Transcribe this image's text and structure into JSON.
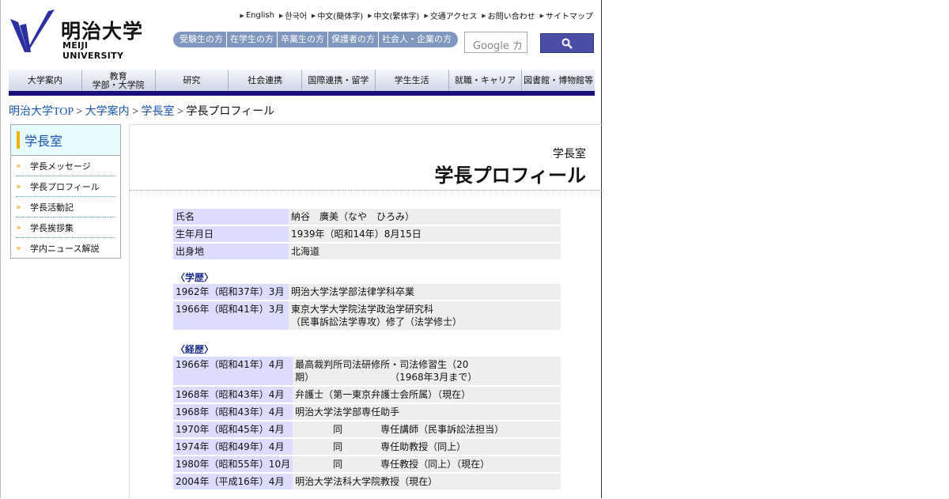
{
  "header": {
    "logo_ja": "明治大学",
    "logo_en": "MEIJI UNIVERSITY",
    "util_links": [
      "English",
      "한국어",
      "中文(簡体字)",
      "中文(繁体字)",
      "交通アクセス",
      "お問い合わせ",
      "サイトマップ"
    ],
    "audience": [
      "受験生の方",
      "在学生の方",
      "卒業生の方",
      "保護者の方",
      "社会人・企業の方"
    ],
    "search_placeholder": "Google カ"
  },
  "gnav": [
    "大学案内",
    "教育\n学部・大学院",
    "研究",
    "社会連携",
    "国際連携・留学",
    "学生生活",
    "就職・キャリア",
    "図書館・博物館等"
  ],
  "breadcrumb": {
    "items": [
      "明治大学TOP",
      "大学案内",
      "学長室"
    ],
    "current": "学長プロフィール",
    "sep": ">"
  },
  "side": {
    "title": "学長室",
    "items": [
      "学長メッセージ",
      "学長プロフィール",
      "学長活動記",
      "学長挨拶集",
      "学内ニュース解説"
    ]
  },
  "main": {
    "subtitle": "学長室",
    "title": "学長プロフィール",
    "basic": [
      {
        "k": "氏名",
        "v": "納谷　廣美（なや　ひろみ）"
      },
      {
        "k": "生年月日",
        "v": "1939年（昭和14年）8月15日"
      },
      {
        "k": "出身地",
        "v": "北海道"
      }
    ],
    "edu_heading": "〈学歴〉",
    "edu": [
      {
        "k": "1962年（昭和37年）3月",
        "v": "明治大学法学部法律学科卒業"
      },
      {
        "k": "1966年（昭和41年）3月",
        "v": "東京大学大学院法学政治学研究科\n（民事訴訟法学専攻）修了（法学修士）"
      }
    ],
    "career_heading": "〈経歴〉",
    "career": [
      {
        "k": "1966年（昭和41年）4月",
        "v": "最高裁判所司法研修所・司法修習生（20\n期）　　　　　　　　　（1968年3月まで）"
      },
      {
        "k": "1968年（昭和43年）4月",
        "v": "弁護士（第一東京弁護士会所属）（現在）"
      },
      {
        "k": "1968年（昭和43年）4月",
        "v": "明治大学法学部専任助手"
      },
      {
        "k": "1970年（昭和45年）4月",
        "v": "　　　　同　　　　専任講師（民事訴訟法担当）"
      },
      {
        "k": "1974年（昭和49年）4月",
        "v": "　　　　同　　　　専任助教授（同上）"
      },
      {
        "k": "1980年（昭和55年）10月",
        "v": "　　　　同　　　　専任教授（同上）（現在）"
      },
      {
        "k": "2004年（平成16年）4月",
        "v": "明治大学法科大学院教授（現在）"
      }
    ]
  },
  "colors": {
    "accent": "#1a0e7a",
    "audience": "#7f97bf",
    "key_cell": "#dcdcff"
  }
}
